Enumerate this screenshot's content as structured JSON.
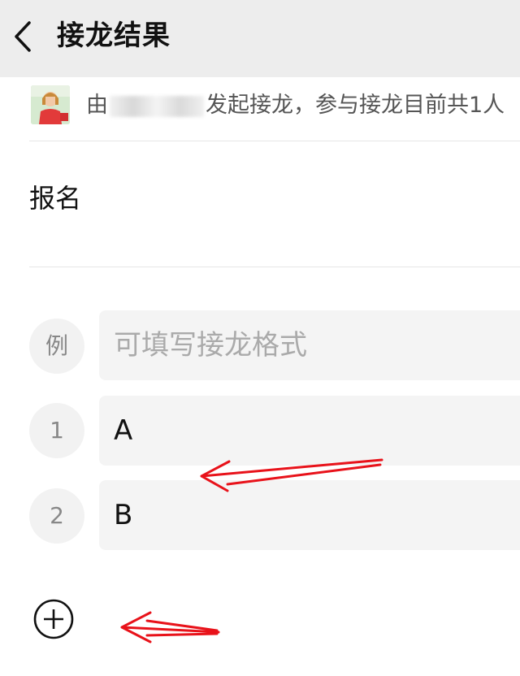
{
  "header": {
    "title": "接龙结果"
  },
  "info": {
    "prefix": "由",
    "suffix": "发起接龙，参与接龙目前共1人"
  },
  "section": {
    "title": "报名"
  },
  "example_row": {
    "label": "例",
    "placeholder": "可填写接龙格式"
  },
  "entries": [
    {
      "number": "1",
      "value": "A"
    },
    {
      "number": "2",
      "value": "B"
    }
  ],
  "colors": {
    "accent_red": "#e8121a",
    "header_bg": "#ededed"
  }
}
